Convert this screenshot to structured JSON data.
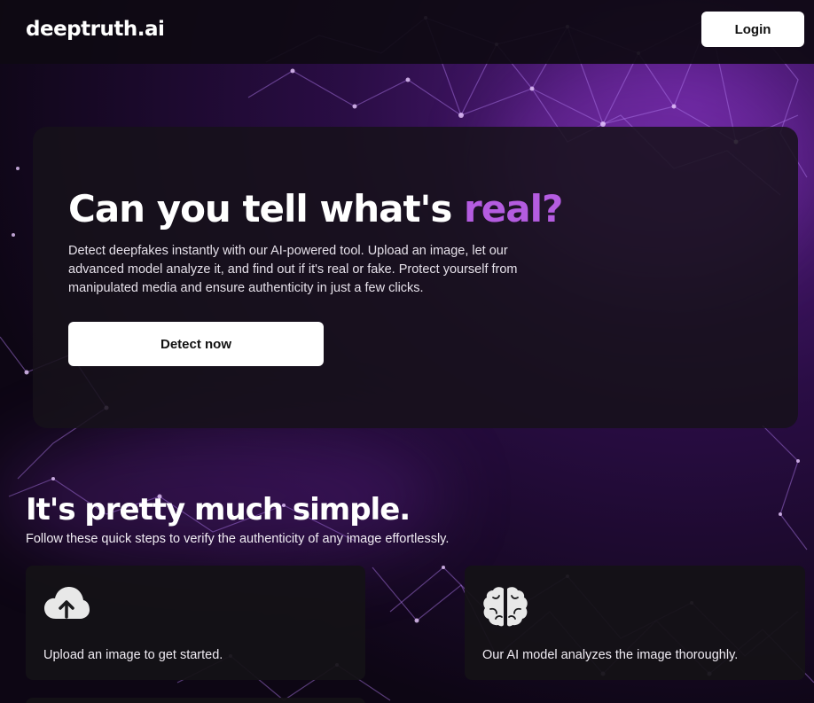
{
  "header": {
    "brand": "deeptruth.ai",
    "login_label": "Login"
  },
  "hero": {
    "title_main": "Can you tell what's ",
    "title_accent": "real?",
    "description": "Detect deepfakes instantly with our AI-powered tool. Upload an image, let our advanced model analyze it, and find out if it's real or fake. Protect yourself from manipulated media and ensure authenticity in just a few clicks.",
    "cta_label": "Detect now"
  },
  "steps": {
    "title": "It's pretty much simple.",
    "subtitle": "Follow these quick steps to verify the authenticity of any image effortlessly.",
    "items": [
      {
        "icon": "cloud-upload-icon",
        "text": "Upload an image to get started."
      },
      {
        "icon": "brain-icon",
        "text": "Our AI model analyzes the image thoroughly."
      }
    ]
  },
  "colors": {
    "accent": "#b45ce0",
    "background": "#0d0614",
    "card": "#16121a"
  }
}
